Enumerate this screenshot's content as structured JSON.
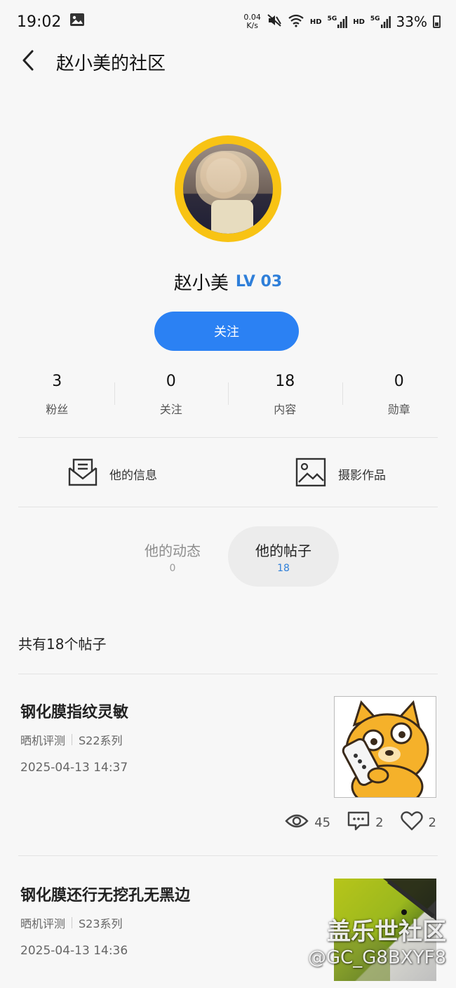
{
  "status_bar": {
    "time": "19:02",
    "net_speed_value": "0.04",
    "net_speed_unit": "K/s",
    "hd1": "HD",
    "sig1": "5G",
    "hd2": "HD",
    "sig2": "5G",
    "battery": "33%"
  },
  "header": {
    "title": "赵小美的社区"
  },
  "profile": {
    "name": "赵小美",
    "level": "LV 03",
    "follow_label": "关注"
  },
  "stats": [
    {
      "value": "3",
      "label": "粉丝"
    },
    {
      "value": "0",
      "label": "关注"
    },
    {
      "value": "18",
      "label": "内容"
    },
    {
      "value": "0",
      "label": "勋章"
    }
  ],
  "quick_links": {
    "info_label": "他的信息",
    "photo_label": "摄影作品"
  },
  "tabs": [
    {
      "label": "他的动态",
      "count": "0"
    },
    {
      "label": "他的帖子",
      "count": "18"
    }
  ],
  "post_count_text": "共有18个帖子",
  "posts": [
    {
      "title": "钢化膜指纹灵敏",
      "tag1": "晒机评测",
      "tag2": "S22系列",
      "date": "2025-04-13 14:37",
      "views": "45",
      "comments": "2",
      "likes": "2"
    },
    {
      "title": "钢化膜还行无挖孔无黑边",
      "tag1": "晒机评测",
      "tag2": "S23系列",
      "date": "2025-04-13 14:36"
    }
  ],
  "watermark": {
    "line1": "盖乐世社区",
    "line2": "@GC_G8BXYF8"
  },
  "colors": {
    "accent": "#2b81f3",
    "level": "#2f7fd9",
    "avatar_ring": "#f8c314"
  }
}
